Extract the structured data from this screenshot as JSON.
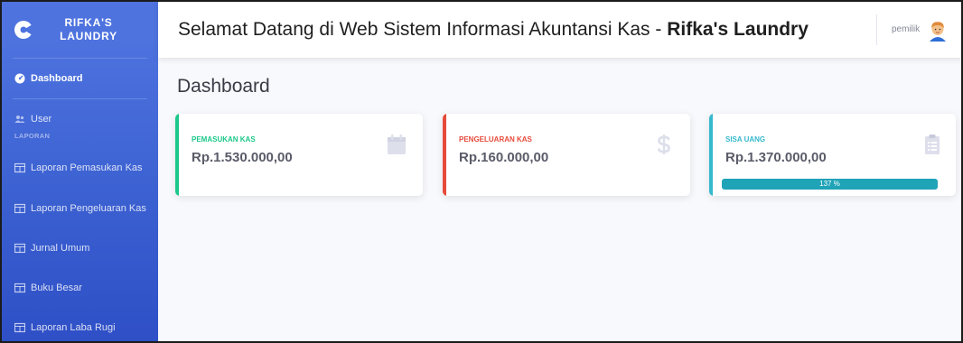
{
  "brand": {
    "name_line1": "RIFKA'S",
    "name_line2": "LAUNDRY"
  },
  "sidebar": {
    "dashboard": "Dashboard",
    "user": "User",
    "section_heading": "LAPORAN",
    "items": [
      {
        "label": "Laporan Pemasukan Kas"
      },
      {
        "label": "Laporan Pengeluaran Kas"
      },
      {
        "label": "Jurnal Umum"
      },
      {
        "label": "Buku Besar"
      },
      {
        "label": "Laporan Laba Rugi"
      }
    ]
  },
  "topbar": {
    "welcome_prefix": "Selamat Datang di Web Sistem Informasi Akuntansi Kas - ",
    "welcome_strong": "Rifka's Laundry",
    "user_name": "pemilik"
  },
  "page": {
    "title": "Dashboard"
  },
  "cards": [
    {
      "label": "PEMASUKAN KAS",
      "value": "Rp.1.530.000,00",
      "color": "#1cc88a",
      "icon": "calendar-icon"
    },
    {
      "label": "PENGELUARAN KAS",
      "value": "Rp.160.000,00",
      "color": "#e74a3b",
      "icon": "dollar-icon"
    },
    {
      "label": "SISA UANG",
      "value": "Rp.1.370.000,00",
      "color": "#36b9cc",
      "icon": "clipboard-icon",
      "progress_text": "137 %",
      "progress_percent": 137
    }
  ]
}
